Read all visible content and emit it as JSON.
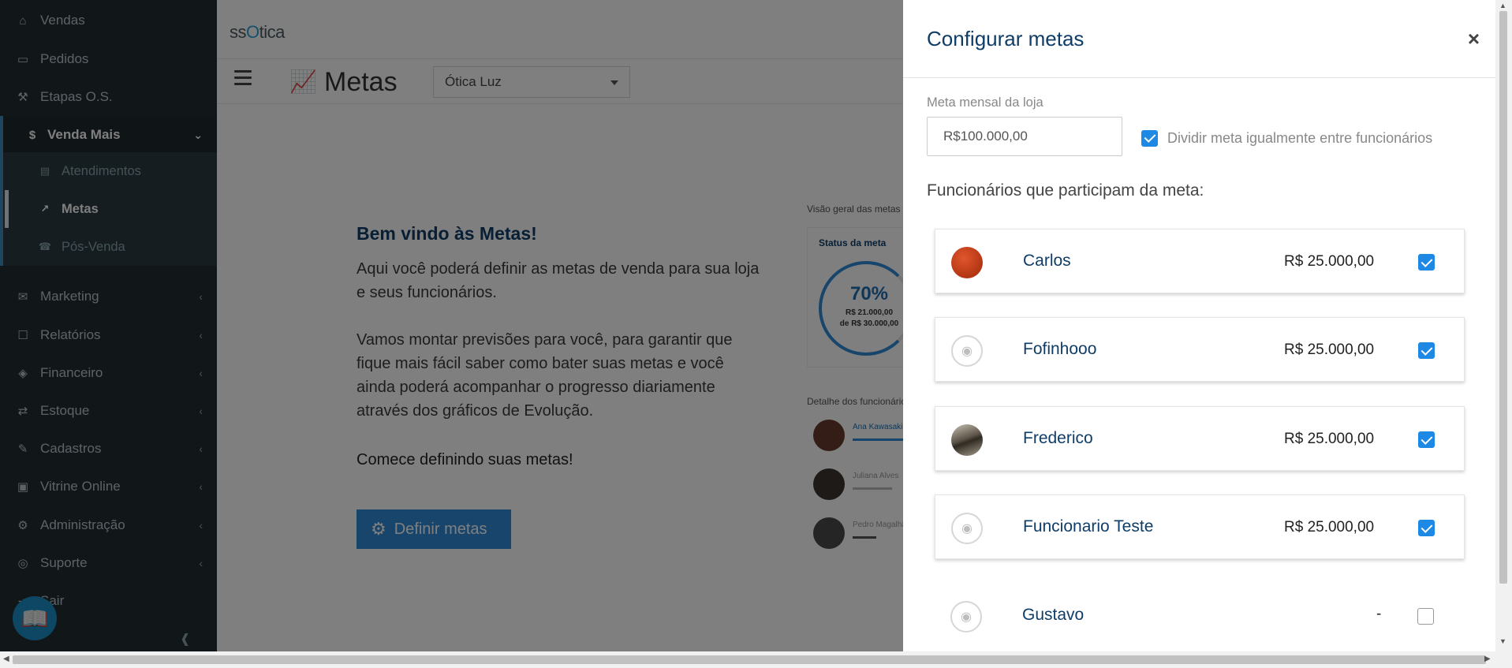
{
  "sidebar": {
    "items": [
      {
        "label": "Vendas",
        "icon": "basket-icon",
        "glyph": "⌂"
      },
      {
        "label": "Pedidos",
        "icon": "inbox-icon",
        "glyph": "▭"
      },
      {
        "label": "Etapas O.S.",
        "icon": "wrench-icon",
        "glyph": "⚒"
      },
      {
        "label": "Venda Mais",
        "icon": "dollar-icon",
        "glyph": "$"
      },
      {
        "label": "Marketing",
        "icon": "comments-icon",
        "glyph": "✉"
      },
      {
        "label": "Relatórios",
        "icon": "reports-icon",
        "glyph": "☐"
      },
      {
        "label": "Financeiro",
        "icon": "money-icon",
        "glyph": "◈"
      },
      {
        "label": "Estoque",
        "icon": "exchange-icon",
        "glyph": "⇄"
      },
      {
        "label": "Cadastros",
        "icon": "edit-icon",
        "glyph": "✎"
      },
      {
        "label": "Vitrine Online",
        "icon": "shopping-bag-icon",
        "glyph": "▣"
      },
      {
        "label": "Administração",
        "icon": "cogs-icon",
        "glyph": "⚙"
      },
      {
        "label": "Suporte",
        "icon": "lifebuoy-icon",
        "glyph": "◎"
      },
      {
        "label": "Sair",
        "icon": "signout-icon",
        "glyph": "⇥"
      }
    ],
    "subitems": [
      {
        "label": "Atendimentos",
        "icon": "clipboard-icon",
        "glyph": "▤"
      },
      {
        "label": "Metas",
        "icon": "line-chart-icon",
        "glyph": "↗"
      },
      {
        "label": "Pós-Venda",
        "icon": "phone-icon",
        "glyph": "☎"
      }
    ]
  },
  "header": {
    "logo_pre": "ss",
    "logo_o": "O",
    "logo_post": "tica",
    "page_title": "Metas",
    "store": "Ótica Luz"
  },
  "welcome": {
    "title": "Bem vindo às Metas!",
    "p1": "Aqui você poderá definir as metas de venda para sua loja e seus funcionários.",
    "p2": "Vamos montar previsões para você, para garantir que fique mais fácil saber como bater suas metas e você ainda poderá acompanhar o progresso diariamente através dos gráficos de Evolução.",
    "cta": "Comece definindo suas metas!",
    "button": "Definir metas"
  },
  "preview": {
    "overview_caption": "Visão geral das metas",
    "status_title": "Status da meta",
    "percent": "70%",
    "value": "R$ 21.000,00",
    "of_value": "de R$ 30.000,00",
    "detail_caption": "Detalhe dos funcionários",
    "employees": [
      "Ana Kawasaki",
      "Juliana Alves",
      "Pedro Magalhães"
    ]
  },
  "panel": {
    "title": "Configurar metas",
    "close": "×",
    "goal_label": "Meta mensal da loja",
    "goal_value": "R$100.000,00",
    "split_label": "Dividir meta igualmente entre funcionários",
    "split_checked": true,
    "participants_label": "Funcionários que participam da meta:",
    "employees": [
      {
        "name": "Carlos",
        "amount": "R$ 25.000,00",
        "checked": true,
        "avatar": "photo"
      },
      {
        "name": "Fofinhooo",
        "amount": "R$ 25.000,00",
        "checked": true,
        "avatar": "placeholder"
      },
      {
        "name": "Frederico",
        "amount": "R$ 25.000,00",
        "checked": true,
        "avatar": "photo"
      },
      {
        "name": "Funcionario Teste",
        "amount": "R$ 25.000,00",
        "checked": true,
        "avatar": "placeholder"
      },
      {
        "name": "Gustavo",
        "amount": "-",
        "checked": false,
        "avatar": "placeholder"
      }
    ]
  },
  "colors": {
    "accent": "#1e88e5",
    "title_blue": "#0f3d68",
    "sidebar_bg": "#222d32"
  }
}
